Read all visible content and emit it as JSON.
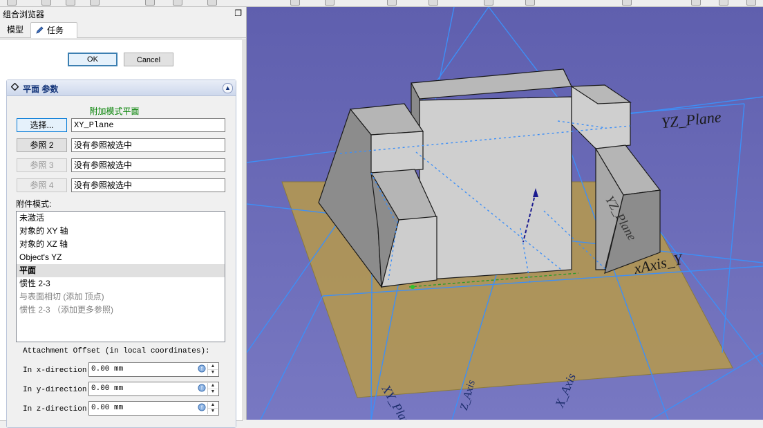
{
  "panel": {
    "title": "组合浏览器",
    "tabs": [
      {
        "label": "模型"
      },
      {
        "label": "任务"
      }
    ]
  },
  "dialog": {
    "ok_label": "OK",
    "cancel_label": "Cancel"
  },
  "section": {
    "title": "平面 参数",
    "mode_status": "附加模式平面",
    "refs": [
      {
        "button": "选择...",
        "value": "XY_Plane",
        "state": "selecting"
      },
      {
        "button": "参照 2",
        "value": "没有参照被选中",
        "state": "enabled"
      },
      {
        "button": "参照 3",
        "value": "没有参照被选中",
        "state": "disabled"
      },
      {
        "button": "参照 4",
        "value": "没有参照被选中",
        "state": "disabled"
      }
    ],
    "attachment_mode_label": "附件模式:",
    "modes": [
      {
        "label": "未激活",
        "selected": false,
        "dim": false
      },
      {
        "label": "对象的 XY 轴",
        "selected": false,
        "dim": false
      },
      {
        "label": "对象的 XZ 轴",
        "selected": false,
        "dim": false
      },
      {
        "label": "Object's YZ",
        "selected": false,
        "dim": false
      },
      {
        "label": "平面",
        "selected": true,
        "dim": false
      },
      {
        "label": "惯性 2-3",
        "selected": false,
        "dim": false
      },
      {
        "label": "与表面相切 (添加 顶点)",
        "selected": false,
        "dim": true
      },
      {
        "label": "惯性 2-3 （添加更多参照)",
        "selected": false,
        "dim": true
      }
    ],
    "offset_label": "Attachment Offset (in local coordinates):",
    "offsets": [
      {
        "label": "In x-direction:",
        "value": "0.00 mm"
      },
      {
        "label": "In y-direction:",
        "value": "0.00 mm"
      },
      {
        "label": "In z-direction:",
        "value": "0.00 mm"
      }
    ]
  },
  "viewport": {
    "labels": {
      "yz_plane": "YZ_Plane",
      "axis_y": "xAxis_Y",
      "x_axis": "X_Axis",
      "xy_plane": "XY_Plane",
      "z_axis": "Z_Axis",
      "yz_mirror": "YZ_Plane"
    },
    "colors": {
      "background": "#6d6db9",
      "plane_fill": "#b79a4a",
      "helper_lines": "#3d8ff7",
      "solid_top": "#d2d2d2",
      "solid_side": "#8c8c8c"
    }
  }
}
